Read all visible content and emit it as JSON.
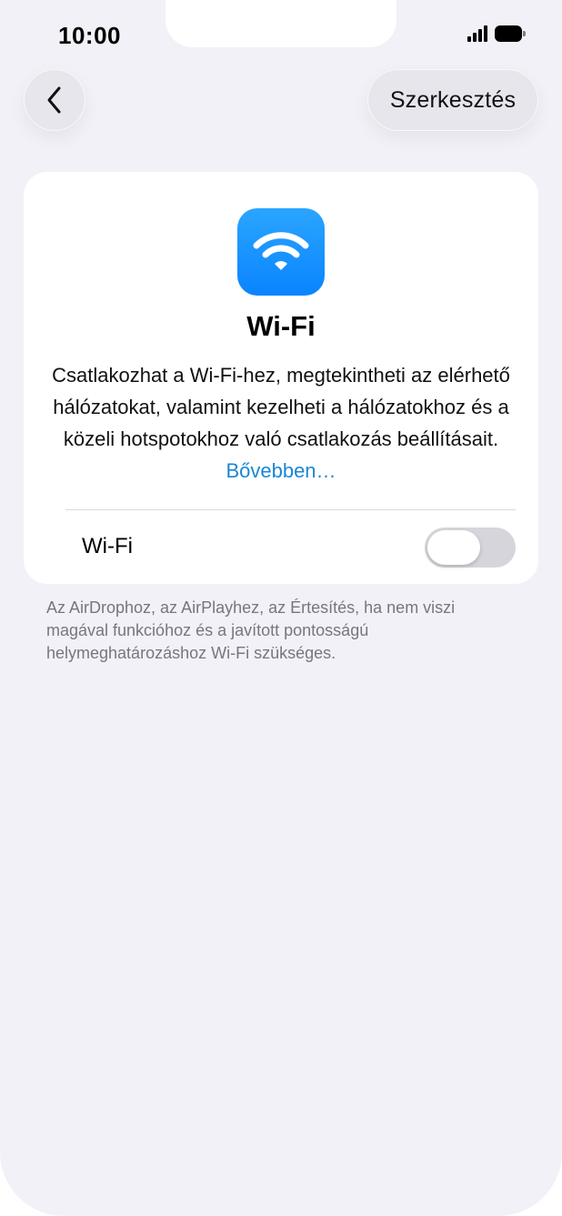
{
  "status_bar": {
    "time": "10:00",
    "signal_icon": "cellular-signal-icon",
    "battery_icon": "battery-icon"
  },
  "nav": {
    "back_icon": "chevron-left-icon",
    "edit_label": "Szerkesztés"
  },
  "card": {
    "icon": "wifi-icon",
    "icon_color": "#0a84ff",
    "title": "Wi-Fi",
    "description": "Csatlakozhat a Wi-Fi-hez, megtekintheti az elérhető hálózatokat, valamint kezelheti a hálózatokhoz és a közeli hotspotokhoz való csatlakozás beállításait.",
    "more_link": "Bővebben…",
    "link_color": "#1a86d6",
    "toggle_label": "Wi-Fi",
    "toggle_on": false
  },
  "footer": {
    "note": "Az AirDrophoz, az AirPlayhez, az Értesítés, ha nem viszi magával funkcióhoz és a javított pontosságú helymeghatározáshoz Wi-Fi szükséges."
  }
}
